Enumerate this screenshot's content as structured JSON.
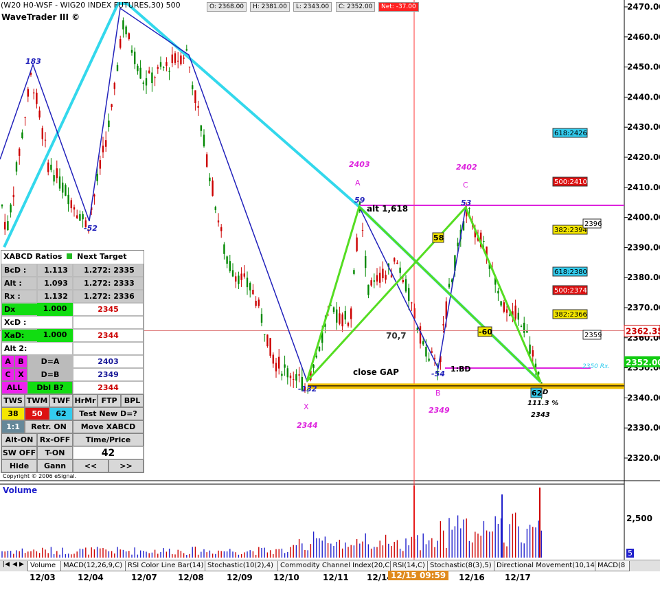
{
  "header": {
    "title": "(W20 H0-WSF - WIG20 INDEX FUTURES,30) 500",
    "open": "O: 2368.00",
    "high": "H: 2381.00",
    "low": "L: 2343.00",
    "close": "C: 2352.00",
    "net": "Net: -37.00",
    "app": "WaveTrader III ©"
  },
  "chart_data": {
    "type": "candlestick",
    "title": "(W20 H0-WSF - WIG20 INDEX FUTURES,30) 500",
    "ylim": [
      2312,
      2472
    ],
    "y_ticks": [
      "2470.00",
      "2460.00",
      "2450.00",
      "2440.00",
      "2430.00",
      "2420.00",
      "2410.00",
      "2400.00",
      "2390.00",
      "2380.00",
      "2370.00",
      "2360.00",
      "2350.00",
      "2340.00",
      "2330.00",
      "2320.00"
    ],
    "x_ticks": [
      "12/03",
      "12/04",
      "12/07",
      "12/08",
      "12/09",
      "12/10",
      "12/11",
      "12/14",
      "12/15 09:59",
      "12/16",
      "12/17"
    ],
    "last_price": "2352.00",
    "cursor_price": "2362.35",
    "volume_label": "Volume",
    "volume_tick": "2,500",
    "volume_last": "5",
    "x_pattern": [
      {
        "label": "X",
        "price": 2344,
        "note": "-132"
      },
      {
        "label": "A",
        "price": 2403,
        "note": "59"
      },
      {
        "label": "B",
        "price": 2349,
        "note": "-54"
      },
      {
        "label": "C",
        "price": 2402,
        "note": "53"
      },
      {
        "label": "D",
        "price": 2343,
        "note": "-60"
      }
    ],
    "swing_labels": [
      "183",
      "-52",
      "59",
      "-132",
      "-54",
      "53",
      "58",
      "-60",
      "62"
    ],
    "text_labels": {
      "a_val": "2403",
      "a": "A",
      "c_val": "2402",
      "c": "C",
      "x": "X",
      "x_val": "2344",
      "b": "B",
      "b_val": "2349",
      "alt": "alt 1,618",
      "gap": "close GAP",
      "ratio": "70,7",
      "bd": "1:BD",
      "pct": "111.3 %",
      "d_val": "2343",
      "d": "D",
      "rx": "2350 Rx."
    },
    "fib_boxes": [
      {
        "label": "618:2426",
        "color": "#33ccee"
      },
      {
        "label": "500:2410",
        "color": "#dd1111"
      },
      {
        "label": "382:2394",
        "color": "#f4e600"
      },
      {
        "label": "618:2380",
        "color": "#33ccee"
      },
      {
        "label": "500:2374",
        "color": "#dd1111"
      },
      {
        "label": "382:2366",
        "color": "#f4e600"
      },
      {
        "label": "2396",
        "color": "#ffffff"
      },
      {
        "label": "2359",
        "color": "#ffffff"
      }
    ],
    "colors": {
      "up": "#008800",
      "down": "#cc0000",
      "cyan": "#33d8ec",
      "green": "#55dd22",
      "blue": "#2222bb",
      "magenta": "#dd22dd",
      "gold": "#f0c000"
    }
  },
  "panel": {
    "title": "XABCD Ratios",
    "next_target": "Next Target",
    "rows": [
      {
        "k": "BcD :",
        "v": "1.113",
        "t": "1.272: 2335"
      },
      {
        "k": "Alt  :",
        "v": "1.093",
        "t": "1.272: 2333"
      },
      {
        "k": "Rx  :",
        "v": "1.132",
        "t": "1.272: 2336"
      }
    ],
    "dx": "Dx",
    "dx_v": "1.000",
    "dx_t": "2345",
    "xcd": "XcD :",
    "xad": "XaD:",
    "xad_v": "1.000",
    "xad_t": "2344",
    "alt2": "Alt 2:",
    "a": "A",
    "b": "B",
    "d_a": "D=A",
    "d_a_v": "2403",
    "c": "C",
    "x": "X",
    "d_b": "D=B",
    "d_b_v": "2349",
    "all": "ALL",
    "dbl": "Dbl B?",
    "dbl_v": "2344",
    "tws": "TWS",
    "twm": "TWM",
    "twf": "TWF",
    "hrmr": "HrMr",
    "ftp": "FTP",
    "bpl": "BPL",
    "n38": "38",
    "n50": "50",
    "n62": "62",
    "test": "Test New D=?",
    "one": "1:1",
    "retr": "Retr. ON",
    "move": "Move XABCD",
    "alton": "Alt-ON",
    "rxoff": "Rx-OFF",
    "tp": "Time/Price",
    "swoff": "SW OFF",
    "ton": "T-ON",
    "num": "42",
    "hide": "Hide",
    "gann": "Gann",
    "prev": "<<",
    "next": ">>",
    "copyright": "Copyright © 2006 eSignal."
  },
  "tabs": [
    "Volume",
    "MACD(12,26,9,C)",
    "RSI Color Line Bar(14)",
    "Stochastic(10(2),4)",
    "Commodity Channel Index(20,C)",
    "RSI(14,C)",
    "Stochastic(8(3),5)",
    "Directional Movement(10,14)",
    "MACD(8"
  ]
}
